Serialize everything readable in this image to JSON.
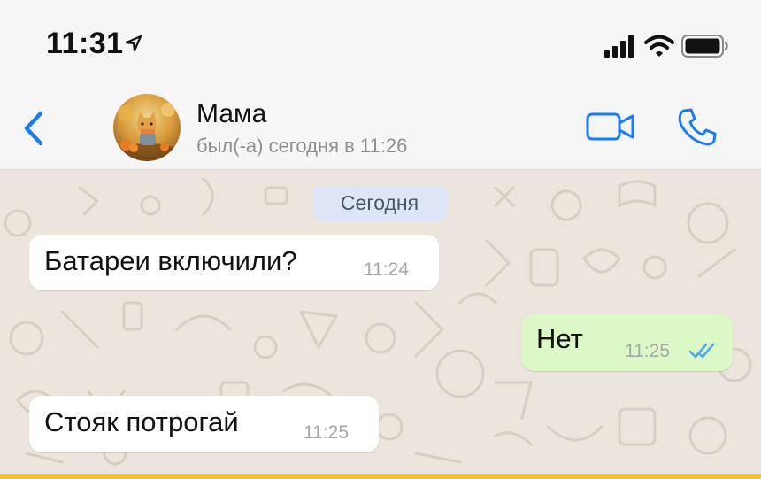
{
  "status_bar": {
    "time": "11:31"
  },
  "header": {
    "contact_name": "Мама",
    "contact_status": "был(-а) сегодня в 11:26"
  },
  "date_separator": "Сегодня",
  "messages": [
    {
      "direction": "incoming",
      "text": "Батареи включили?",
      "time": "11:24"
    },
    {
      "direction": "outgoing",
      "text": "Нет",
      "time": "11:25",
      "status": "read"
    },
    {
      "direction": "incoming",
      "text": "Стояк потрогай",
      "time": "11:25"
    }
  ],
  "colors": {
    "accent": "#1a7cf5",
    "outgoing_bubble": "#dcf8c6",
    "incoming_bubble": "#ffffff",
    "read_ticks": "#4fa8e8",
    "date_chip": "#dde5f6"
  },
  "icons": {
    "location": "location-arrow-icon",
    "signal": "cellular-signal-icon",
    "wifi": "wifi-icon",
    "battery": "battery-icon",
    "back": "chevron-left-icon",
    "video": "video-camera-icon",
    "call": "phone-icon",
    "ticks": "double-check-icon"
  }
}
